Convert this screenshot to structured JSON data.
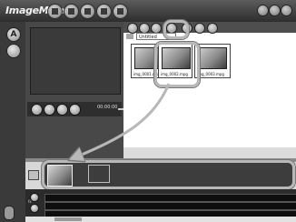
{
  "app": {
    "title": "ImageMixer"
  },
  "library": {
    "folder_name": "Untitled",
    "thumbnails": [
      {
        "name": "img_0001.mpg"
      },
      {
        "name": "img_0002.mpg"
      },
      {
        "name": "img_0003.mpg"
      }
    ]
  },
  "player": {
    "timecode": "00:00:00"
  },
  "left_tools": {
    "a_label": "A"
  },
  "timeline": {
    "track_label": "fx"
  },
  "colors": {
    "highlight": "#b8b8b8",
    "panel_dark": "#3d3d3d",
    "panel_light": "#ffffff"
  }
}
